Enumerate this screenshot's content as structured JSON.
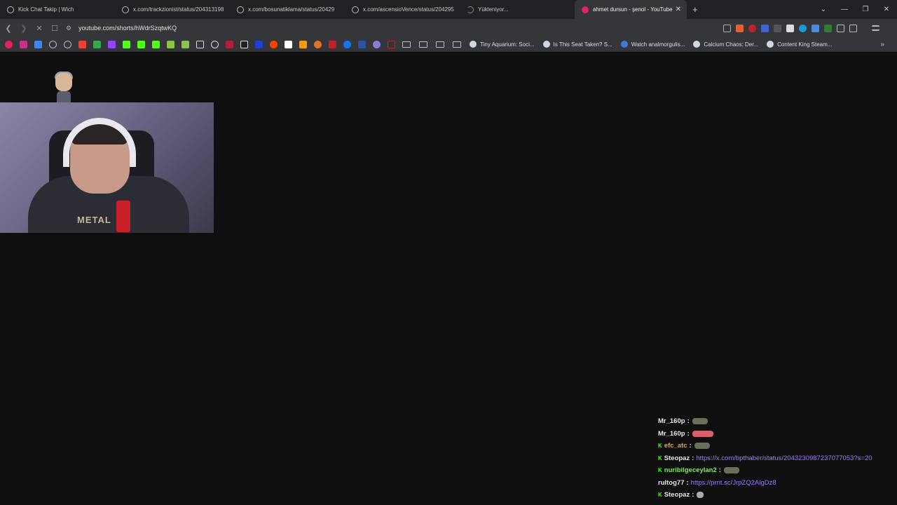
{
  "tabs": [
    {
      "title": "Kick Chat Takip | Wich",
      "icon": "globe-icon",
      "active": false
    },
    {
      "title": "x.com/trackzionist/status/204313198",
      "icon": "globe-icon",
      "active": false
    },
    {
      "title": "x.com/bosunatiklama/status/20429",
      "icon": "globe-icon",
      "active": false
    },
    {
      "title": "x.com/ascensioVence/status/204295",
      "icon": "globe-icon",
      "active": false
    },
    {
      "title": "Yükleniyor...",
      "icon": "loading-spinner-icon",
      "active": false
    },
    {
      "title": "ahmet dursun - şenol - YouTube",
      "icon": "youtube-icon",
      "active": true
    }
  ],
  "address": {
    "url": "youtube.com/shorts/hWdrSzqtwKQ"
  },
  "bookmarks": {
    "items": [
      {
        "label": "Tiny Aquarium: Soci..."
      },
      {
        "label": "Is This Seat Taken? S..."
      },
      {
        "label": "Watch analmorgulis..."
      },
      {
        "label": "Calcium Chaos: Der..."
      },
      {
        "label": "Content King Steam..."
      }
    ]
  },
  "webcam": {
    "shirt_text": "METAL"
  },
  "chat": {
    "messages": [
      {
        "user": "Mr_160p",
        "sep": ":",
        "color": "#e8e8e8",
        "badge": "",
        "link": "",
        "emote": "plain"
      },
      {
        "user": "Mr_160p",
        "sep": ":",
        "color": "#e8e8e8",
        "badge": "",
        "link": "",
        "emote": "red"
      },
      {
        "user": "efc_atc",
        "sep": ":",
        "color": "#e6a23c",
        "badge": "K",
        "link": "",
        "emote": "plain"
      },
      {
        "user": "Steopaz",
        "sep": ":",
        "color": "#e8e8e8",
        "badge": "K",
        "link": "https://x.com/bpthaber/status/2043230987237077053?s=20",
        "emote": ""
      },
      {
        "user": "nuribilgeceylan2",
        "sep": ":",
        "color": "#8be36a",
        "badge": "K",
        "link": "",
        "emote": "plain"
      },
      {
        "user": "rultog77",
        "sep": ":",
        "color": "#e8e8e8",
        "badge": "",
        "link": "https://prnt.sc/JrpZQ2AlgDz8",
        "emote": ""
      },
      {
        "user": "Steopaz",
        "sep": ":",
        "color": "#e8e8e8",
        "badge": "K",
        "link": "",
        "emote": "small"
      }
    ]
  }
}
